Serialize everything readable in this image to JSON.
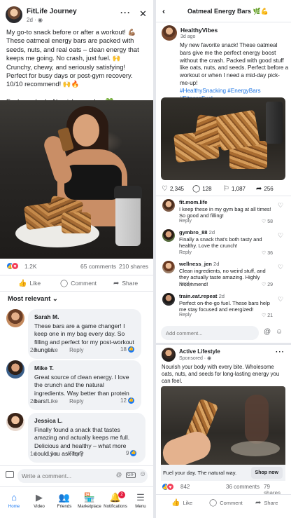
{
  "left_post": {
    "author": "FitLife Journey",
    "time": "2d · ◉",
    "text": [
      "My go-to snack before or after a workout! 💪🏽",
      "These oatmeal energy bars are packed with seeds, nuts, and real oats – clean energy that keeps me going. No crash, just fuel. 🙌",
      "Crunchy, chewy, and seriously satisfying!",
      "Perfect for busy days or post-gym recovery.",
      "10/10 recommend! 🙌🔥",
      "Fuel your body. Nourish your day. 💚"
    ],
    "reactions": {
      "count": "1.2K",
      "comments": "65 comments",
      "shares": "210 shares"
    },
    "actions": {
      "like": "Like",
      "comment": "Comment",
      "share": "Share"
    },
    "sort_label": "Most relevant ⌄",
    "comments": [
      {
        "name": "Sarah M.",
        "text": "These bars are a game changer! I keep one in my bag every day. So filling and perfect for my post-workout hunger.",
        "time": "2d",
        "like": "Like",
        "reply": "Reply",
        "likes": "18"
      },
      {
        "name": "Mike T.",
        "text": "Great source of clean energy. I love the crunch and the natural ingredients. Way better than protein bars!",
        "time": "2d",
        "like": "Like",
        "reply": "Reply",
        "likes": "12"
      },
      {
        "name": "Jessica L.",
        "text": "Finally found a snack that tastes amazing and actually keeps me full. Delicious and healthy – what more could you ask for?",
        "time": "1d",
        "like": "Like",
        "reply": "Reply",
        "likes": "9"
      }
    ],
    "comment_placeholder": "Write a comment...",
    "input_icons": {
      "at": "@",
      "gif": "GIF",
      "emoji": "☺"
    }
  },
  "tabbar": {
    "tabs": [
      {
        "label": "Home",
        "icon": "⌂"
      },
      {
        "label": "Video",
        "icon": "▶"
      },
      {
        "label": "Friends",
        "icon": "👥"
      },
      {
        "label": "Marketplace",
        "icon": "🏪"
      },
      {
        "label": "Notifications",
        "icon": "🔔",
        "badge": "2"
      },
      {
        "label": "Menu",
        "icon": "☰"
      }
    ],
    "active_color": "#1877f2"
  },
  "right_post": {
    "title": "Oatmeal Energy Bars 🌿💪",
    "author": "HealthyVibes",
    "time": "3d ago",
    "text": "My new favorite snack! These oatmeal bars give me the perfect energy boost without the crash. Packed with good stuff like oats, nuts, and seeds. Perfect before a workout or when I need a mid-day pick-me-up!",
    "hashtags": "#HealthySnacking #EnergyBars #FitnessFuel",
    "reactions": {
      "likes": "2,345",
      "comments": "128",
      "saves": "1,087",
      "shares": "256"
    },
    "comments": [
      {
        "name": "fit.mom.life",
        "text": "I keep these in my gym bag at all times! So good and filling!",
        "reply": "Reply",
        "likes": "58"
      },
      {
        "name": "gymbro_88",
        "time": "2d",
        "text": "Finally a snack that's both tasty and healthy. Love the crunch!",
        "reply": "Reply",
        "likes": "36"
      },
      {
        "name": "wellness_jen",
        "time": "2d",
        "text": "Clean ingredients, no weird stuff, and they actually taste amazing. Highly recommend!",
        "reply": "Reply",
        "likes": "29"
      },
      {
        "name": "train.eat.repeat",
        "time": "2d",
        "text": "Perfect on-the-go fuel. These bars help me stay focused and energized!",
        "reply": "Reply",
        "likes": "21"
      }
    ],
    "add_comment_placeholder": "Add comment...",
    "add_icons": {
      "at": "@",
      "emoji": "☺"
    }
  },
  "ad": {
    "author": "Active Lifestyle",
    "sponsored": "Sponsored · ◉",
    "text": "Nourish your body with every bite. Wholesome oats, nuts, and seeds for long-lasting energy you can feel.",
    "cta_text": "Fuel your day. The natural way.",
    "cta_button": "Shop now",
    "reactions": {
      "count": "842",
      "comments": "36 comments",
      "shares": "79 shares"
    },
    "actions": {
      "like": "Like",
      "comment": "Comment",
      "share": "Share"
    }
  }
}
